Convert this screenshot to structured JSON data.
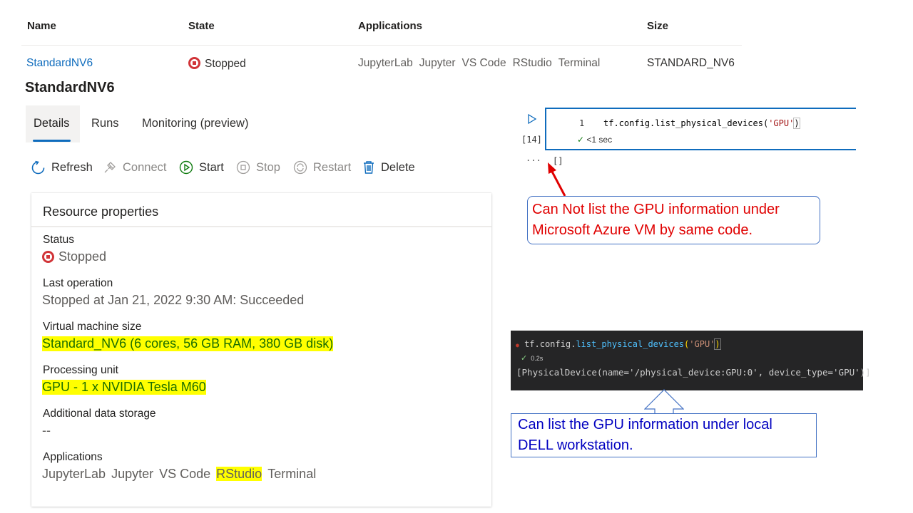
{
  "table": {
    "headers": [
      "Name",
      "State",
      "Applications",
      "Size"
    ],
    "row": {
      "name": "StandardNV6",
      "state": "Stopped",
      "applications": [
        "JupyterLab",
        "Jupyter",
        "VS Code",
        "RStudio",
        "Terminal"
      ],
      "size": "STANDARD_NV6"
    }
  },
  "page_title": "StandardNV6",
  "tabs": [
    {
      "label": "Details",
      "selected": true
    },
    {
      "label": "Runs",
      "selected": false
    },
    {
      "label": "Monitoring (preview)",
      "selected": false
    }
  ],
  "toolbar": {
    "refresh": "Refresh",
    "connect": "Connect",
    "start": "Start",
    "stop": "Stop",
    "restart": "Restart",
    "delete": "Delete"
  },
  "resource_properties": {
    "title": "Resource properties",
    "status_label": "Status",
    "status_value": "Stopped",
    "last_operation_label": "Last operation",
    "last_operation_value": "Stopped at Jan 21, 2022 9:30 AM: Succeeded",
    "vm_size_label": "Virtual machine size",
    "vm_size_value": "Standard_NV6 (6 cores, 56 GB RAM, 380 GB disk)",
    "processing_unit_label": "Processing unit",
    "processing_unit_value": "GPU - 1 x NVIDIA Tesla M60",
    "additional_storage_label": "Additional data storage",
    "additional_storage_value": "--",
    "applications_label": "Applications",
    "applications": [
      "JupyterLab",
      "Jupyter",
      "VS Code",
      "RStudio",
      "Terminal"
    ]
  },
  "notebook_cell_azure": {
    "line_number": "1",
    "code_fn": "tf.config.list_physical_devices(",
    "code_arg": "'GPU'",
    "code_close": ")",
    "exec_count": "[14]",
    "exec_time": "<1 sec",
    "output_ellipsis": "...",
    "output": "[]"
  },
  "callout_azure": {
    "text_line1": "Can Not list the GPU information under",
    "text_line2": "Microsoft Azure VM by same code.",
    "color": "#e00000"
  },
  "notebook_cell_local": {
    "code_obj": "tf.config.",
    "code_fn": "list_physical_devices",
    "code_open": "(",
    "code_arg": "'GPU'",
    "code_close": ")",
    "exec_time": "0.2s",
    "output": "[PhysicalDevice(name='/physical_device:GPU:0', device_type='GPU')]"
  },
  "callout_local": {
    "text_line1": "Can list the GPU  information under local",
    "text_line2": "DELL workstation.",
    "color": "#0000c0"
  },
  "colors": {
    "accent": "#0f6cbd",
    "stopped": "#d13438",
    "highlight": "#ffff00",
    "start_green": "#107c10"
  }
}
